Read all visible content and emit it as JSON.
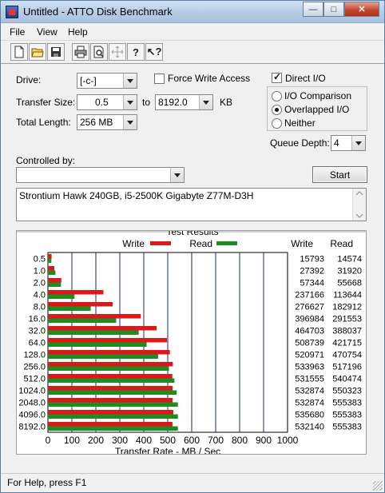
{
  "window": {
    "title": "Untitled - ATTO Disk Benchmark"
  },
  "menu": [
    {
      "label": "File"
    },
    {
      "label": "View"
    },
    {
      "label": "Help"
    }
  ],
  "toolbar": [
    "new-file-icon",
    "open-folder-icon",
    "save-icon",
    "print-icon",
    "print-preview-icon",
    "move-icon",
    "help-icon",
    "context-help-icon"
  ],
  "form": {
    "drive_label": "Drive:",
    "drive_value": "[-c-]",
    "force_write_access_label": "Force Write Access",
    "force_write_access_checked": false,
    "direct_io_label": "Direct I/O",
    "direct_io_checked": true,
    "transfer_size_label": "Transfer Size:",
    "transfer_size_from": "0.5",
    "to_label": "to",
    "transfer_size_to": "8192.0",
    "kb_label": "KB",
    "total_length_label": "Total Length:",
    "total_length_value": "256 MB",
    "io_comparison_label": "I/O Comparison",
    "overlapped_io_label": "Overlapped I/O",
    "neither_label": "Neither",
    "selected_mode": "Overlapped I/O",
    "queue_depth_label": "Queue Depth:",
    "queue_depth_value": "4",
    "controlled_by_label": "Controlled by:",
    "controlled_by_value": "",
    "start_label": "Start",
    "description": "Strontium Hawk 240GB, i5-2500K Gigabyte Z77M-D3H"
  },
  "results": {
    "title": "Test Results",
    "legend_write": "Write",
    "legend_read": "Read",
    "col_write": "Write",
    "col_read": "Read",
    "write_color": "#d91a1a",
    "read_color": "#1e8c1e"
  },
  "chart_data": {
    "type": "bar",
    "orientation": "horizontal",
    "xlabel": "Transfer Rate - MB / Sec",
    "xlim": [
      0,
      1000
    ],
    "xticks": [
      "0",
      "100",
      "200",
      "300",
      "400",
      "500",
      "600",
      "700",
      "800",
      "900",
      "1000"
    ],
    "categories": [
      "0.5",
      "1.0",
      "2.0",
      "4.0",
      "8.0",
      "16.0",
      "32.0",
      "64.0",
      "128.0",
      "256.0",
      "512.0",
      "1024.0",
      "2048.0",
      "4096.0",
      "8192.0"
    ],
    "series": [
      {
        "name": "Write",
        "values_kb": [
          "15793",
          "27392",
          "57344",
          "237166",
          "276627",
          "396984",
          "464703",
          "508739",
          "520971",
          "533963",
          "531555",
          "532874",
          "532874",
          "535680",
          "532140"
        ]
      },
      {
        "name": "Read",
        "values_kb": [
          "14574",
          "31920",
          "55668",
          "113644",
          "182912",
          "291553",
          "388037",
          "421715",
          "470754",
          "517196",
          "540474",
          "550323",
          "555383",
          "555383",
          "555383"
        ]
      }
    ],
    "grid": true,
    "legend": "top"
  },
  "status": {
    "text": "For Help, press F1"
  }
}
